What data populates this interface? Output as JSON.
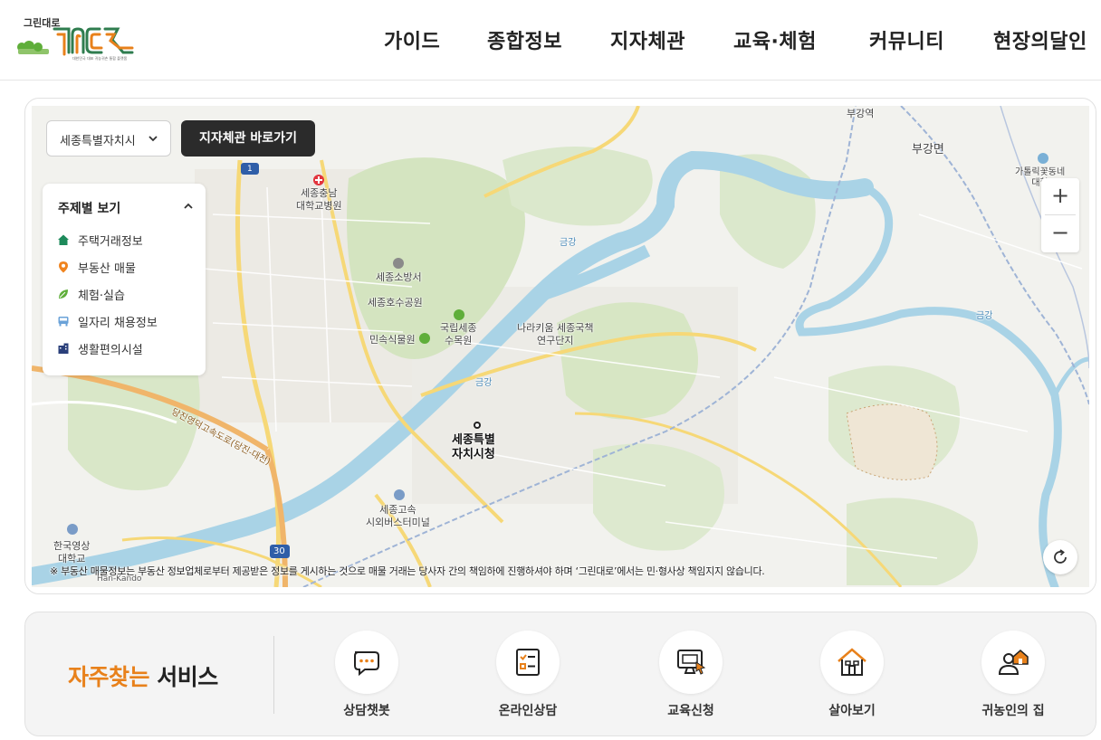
{
  "header": {
    "logo_small_text": "그린대로",
    "logo_tagline": "대한민국 대표 귀농귀촌 통합 플랫폼",
    "nav": [
      "가이드",
      "종합정보",
      "지자체관",
      "교육·체험",
      "커뮤니티",
      "현장의달인"
    ]
  },
  "map": {
    "region_select": {
      "value": "세종특별자치시"
    },
    "goto_button": "지자체관 바로가기",
    "theme_panel": {
      "title": "주제별 보기",
      "items": [
        {
          "label": "주택거래정보",
          "icon": "house-icon",
          "color": "#1d8a5b"
        },
        {
          "label": "부동산 매물",
          "icon": "location-pin-icon",
          "color": "#f0841f"
        },
        {
          "label": "체험·실습",
          "icon": "leaf-icon",
          "color": "#5fae3a"
        },
        {
          "label": "일자리 채용정보",
          "icon": "bus-icon",
          "color": "#6aa2d8"
        },
        {
          "label": "생활편의시설",
          "icon": "building-icon",
          "color": "#2a3f7a"
        }
      ]
    },
    "zoom_in": "+",
    "zoom_out": "−",
    "disclaimer": "※ 부동산 매물정보는 부동산 정보업체로부터 제공받은 정보를 게시하는 것으로 매물 거래는 당사자 간의 책임하에 진행하셔야 하며 ‘그린대로’에서는 민·형사상 책임지지 않습니다.",
    "labels": {
      "hospital": "세종충남\n대학교병원",
      "fire_station": "세종소방서",
      "lake_park": "세종호수공원",
      "arboretum": "국립세종\n수목원",
      "folk_garden": "민속식물원",
      "research": "나라키움 세종국책\n연구단지",
      "city_hall": "세종특별\n자치시청",
      "terminal": "세종고속\n시외버스터미널",
      "university": "한국영상\n대학교",
      "bugang_station": "부강역",
      "bugang_myeon": "부강면",
      "flower_village": "가톨릭꽃동네\n대학",
      "river1": "금강",
      "river2": "금강",
      "river3": "금강",
      "expressway": "당진영덕고속도로(당진-대전)",
      "route_1": "1",
      "route_30": "30",
      "hidden_text": "Han-Kando"
    },
    "colors": {
      "river": "#a9d3e6",
      "green": "#d6e5c3",
      "road": "#f6d877",
      "expressway": "#f0b56a"
    }
  },
  "services": {
    "title_accent": "자주찾는",
    "title_rest": " 서비스",
    "accent_color": "#e8811b",
    "items": [
      {
        "label": "상담챗봇",
        "icon": "chat-bubble-icon"
      },
      {
        "label": "온라인상담",
        "icon": "checklist-icon"
      },
      {
        "label": "교육신청",
        "icon": "monitor-click-icon"
      },
      {
        "label": "살아보기",
        "icon": "house-icon"
      },
      {
        "label": "귀농인의 집",
        "icon": "person-home-icon"
      }
    ]
  }
}
